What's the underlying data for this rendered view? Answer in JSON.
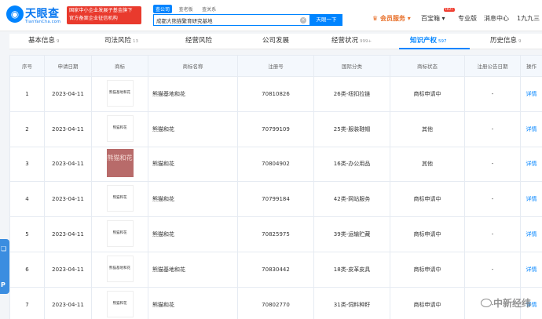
{
  "header": {
    "logo_char": "◉",
    "logo_name": "天眼查",
    "logo_domain": "TianYanCha.com",
    "promo_line1": "国家中小企业发展子基金旗下",
    "promo_line2": "官方备案企业征信机构",
    "scope_tabs": [
      "查公司",
      "查老板",
      "查关系"
    ],
    "search_value": "成都大熊猫繁育研究基地",
    "search_button": "天眼一下",
    "nav": {
      "vip": "会员服务",
      "app": "百宝箱",
      "hot": "HOT",
      "pro": "专业版",
      "msg": "消息中心",
      "user": "1九九三"
    }
  },
  "tabs": [
    {
      "label": "基本信息",
      "count": "9"
    },
    {
      "label": "司法风险",
      "count": "13"
    },
    {
      "label": "经营风险",
      "count": ""
    },
    {
      "label": "公司发展",
      "count": ""
    },
    {
      "label": "经营状况",
      "count": "999+"
    },
    {
      "label": "知识产权",
      "count": "597"
    },
    {
      "label": "历史信息",
      "count": "9"
    }
  ],
  "table": {
    "columns": [
      "序号",
      "申请日期",
      "商标",
      "商标名称",
      "注册号",
      "国际分类",
      "商标状态",
      "注册公告日期",
      "操作"
    ],
    "rows": [
      {
        "no": "1",
        "date": "2023-04-11",
        "logo": "熊猫基地和花",
        "name": "熊猫基地和花",
        "reg": "70810826",
        "class": "26类-纽扣拉链",
        "status": "商标申请中",
        "notice": "-",
        "op": "详情"
      },
      {
        "no": "2",
        "date": "2023-04-11",
        "logo": "熊猫和花",
        "name": "熊猫和花",
        "reg": "70799109",
        "class": "25类-服装鞋帽",
        "status": "其他",
        "notice": "-",
        "op": "详情"
      },
      {
        "no": "3",
        "date": "2023-04-11",
        "logo": "熊猫和花",
        "name": "熊猫和花",
        "reg": "70804902",
        "class": "16类-办公用品",
        "status": "其他",
        "notice": "-",
        "op": "详情"
      },
      {
        "no": "4",
        "date": "2023-04-11",
        "logo": "熊猫和花",
        "name": "熊猫和花",
        "reg": "70799184",
        "class": "42类-网站服务",
        "status": "商标申请中",
        "notice": "-",
        "op": "详情"
      },
      {
        "no": "5",
        "date": "2023-04-11",
        "logo": "熊猫和花",
        "name": "熊猫和花",
        "reg": "70825975",
        "class": "39类-运输贮藏",
        "status": "商标申请中",
        "notice": "-",
        "op": "详情"
      },
      {
        "no": "6",
        "date": "2023-04-11",
        "logo": "熊猫基地和花",
        "name": "熊猫基地和花",
        "reg": "70830442",
        "class": "18类-皮革皮具",
        "status": "商标申请中",
        "notice": "-",
        "op": "详情"
      },
      {
        "no": "7",
        "date": "2023-04-11",
        "logo": "熊猫和花",
        "name": "熊猫和花",
        "reg": "70802770",
        "class": "31类-饲料种籽",
        "status": "商标申请中",
        "notice": "-",
        "op": "详情"
      }
    ]
  },
  "side_float": {
    "line1": "❏",
    "line2": "P"
  },
  "watermark": "中新经纬"
}
